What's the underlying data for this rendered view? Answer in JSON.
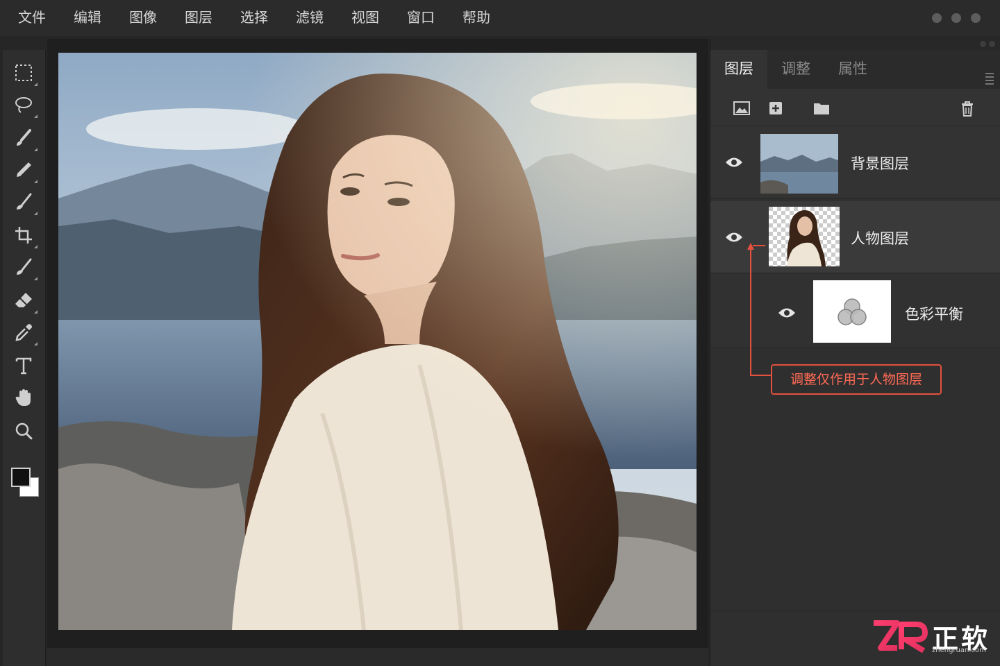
{
  "menu": [
    "文件",
    "编辑",
    "图像",
    "图层",
    "选择",
    "滤镜",
    "视图",
    "窗口",
    "帮助"
  ],
  "tools": [
    {
      "name": "marquee-icon"
    },
    {
      "name": "lasso-icon"
    },
    {
      "name": "quick-select-brush-icon"
    },
    {
      "name": "healing-pencil-icon"
    },
    {
      "name": "brush-icon"
    },
    {
      "name": "crop-icon"
    },
    {
      "name": "clone-brush-icon"
    },
    {
      "name": "eraser-icon"
    },
    {
      "name": "eyedropper-icon"
    },
    {
      "name": "text-icon"
    },
    {
      "name": "hand-icon"
    },
    {
      "name": "zoom-icon"
    }
  ],
  "colors": {
    "foreground": "#111111",
    "background": "#ffffff",
    "accent": "#e4513f"
  },
  "panel": {
    "tabs": [
      "图层",
      "调整",
      "属性"
    ],
    "active_tab": "图层",
    "toolbar_icons": [
      "image-layer-icon",
      "add-layer-icon",
      "folder-icon",
      "trash-icon"
    ]
  },
  "layers": [
    {
      "name": "背景图层",
      "visible": true,
      "type": "image"
    },
    {
      "name": "人物图层",
      "visible": true,
      "type": "image",
      "selected": true,
      "transparent_bg": true
    },
    {
      "name": "色彩平衡",
      "visible": true,
      "type": "adjustment",
      "clipped_to": "人物图层"
    }
  ],
  "annotation": "调整仅作用于人物图层",
  "watermark": {
    "brand": "正软",
    "logo": "ZR",
    "domain": "zhengruan.com"
  }
}
